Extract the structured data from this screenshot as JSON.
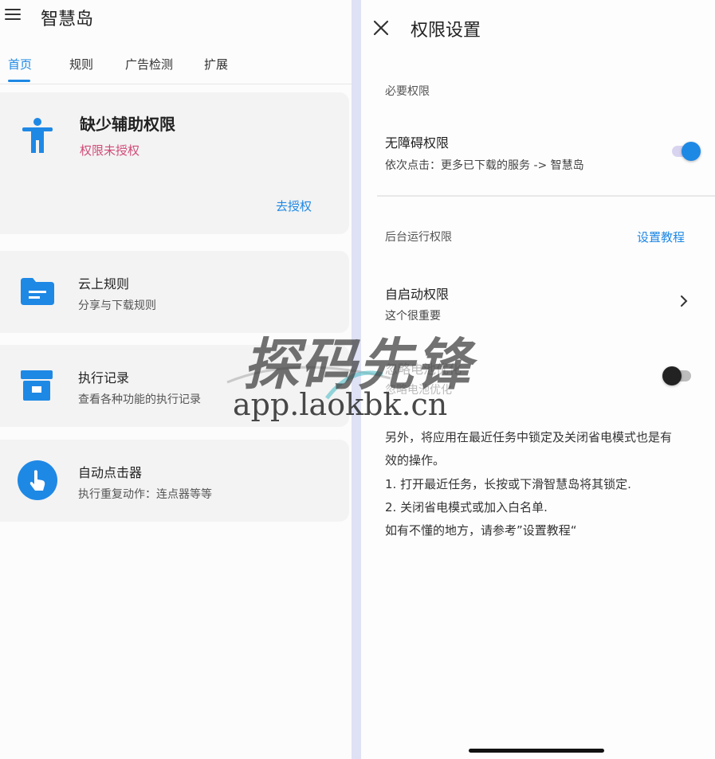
{
  "left": {
    "app_title": "智慧岛",
    "tabs": [
      "首页",
      "规则",
      "广告检测",
      "扩展"
    ],
    "auth_card": {
      "title": "缺少辅助权限",
      "status": "权限未授权",
      "action": "去授权"
    },
    "cards": [
      {
        "title": "云上规则",
        "subtitle": "分享与下载规则"
      },
      {
        "title": "执行记录",
        "subtitle": "查看各种功能的执行记录"
      },
      {
        "title": "自动点击器",
        "subtitle": "执行重复动作：连点器等等"
      }
    ]
  },
  "right": {
    "title": "权限设置",
    "required_label": "必要权限",
    "accessibility": {
      "title": "无障碍权限",
      "subtitle": "依次点击：更多已下载的服务 -> 智慧岛",
      "enabled": true
    },
    "background_label": "后台运行权限",
    "tutorial_link": "设置教程",
    "autostart": {
      "title": "自启动权限",
      "subtitle": "这个很重要"
    },
    "battery": {
      "title": "忽略电池优化",
      "subtitle": "忽略电池优化",
      "enabled": false
    },
    "notes": [
      "另外，将应用在最近任务中锁定及关闭省电模式也是有",
      "效的操作。",
      "1. 打开最近任务，长按或下滑智慧岛将其锁定.",
      "2. 关闭省电模式或加入白名单.",
      "如有不懂的地方，请参考”设置教程“"
    ]
  },
  "watermark": {
    "text": "探码先锋",
    "url": "app.laokbk.cn"
  },
  "colors": {
    "accent": "#1e88e5",
    "warning": "#d14b79",
    "divider": "#dfe2f5"
  }
}
